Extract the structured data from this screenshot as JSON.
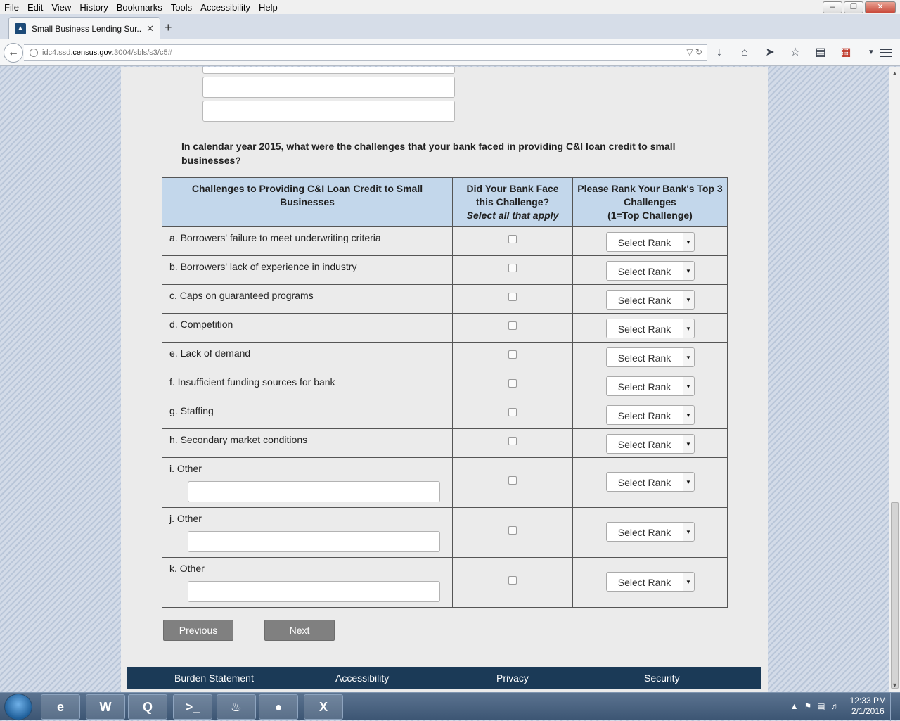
{
  "browser": {
    "menu": [
      "File",
      "Edit",
      "View",
      "History",
      "Bookmarks",
      "Tools",
      "Accessibility",
      "Help"
    ],
    "tab_title": "Small Business Lending Sur...",
    "url_prefix": "idc4.ssd.",
    "url_domain": "census.gov",
    "url_suffix": ":3004/sbls/s3/c5#"
  },
  "question": "In calendar year 2015, what were the challenges that your bank faced in providing C&I loan credit to small businesses?",
  "table": {
    "headers": {
      "challenge": "Challenges to Providing C&I Loan Credit to Small Businesses",
      "faced_line1": "Did Your Bank Face this Challenge?",
      "faced_sub": "Select all that apply",
      "rank_line1": "Please Rank Your Bank's Top 3 Challenges",
      "rank_line2": "(1=Top Challenge)"
    },
    "rows": [
      {
        "letter": "a.",
        "label": "Borrowers' failure to meet underwriting criteria",
        "rank": "Select Rank"
      },
      {
        "letter": "b.",
        "label": "Borrowers' lack of experience in industry",
        "rank": "Select Rank"
      },
      {
        "letter": "c.",
        "label": "Caps on guaranteed programs",
        "rank": "Select Rank"
      },
      {
        "letter": "d.",
        "label": "Competition",
        "rank": "Select Rank"
      },
      {
        "letter": "e.",
        "label": "Lack of demand",
        "rank": "Select Rank"
      },
      {
        "letter": "f.",
        "label": "Insufficient funding sources for bank",
        "rank": "Select Rank"
      },
      {
        "letter": "g.",
        "label": "Staffing",
        "rank": "Select Rank"
      },
      {
        "letter": "h.",
        "label": "Secondary market conditions",
        "rank": "Select Rank"
      },
      {
        "letter": "i.",
        "label": "Other",
        "rank": "Select Rank"
      },
      {
        "letter": "j.",
        "label": "Other",
        "rank": "Select Rank"
      },
      {
        "letter": "k.",
        "label": "Other",
        "rank": "Select Rank"
      }
    ]
  },
  "buttons": {
    "previous": "Previous",
    "next": "Next"
  },
  "footer": [
    "Burden Statement",
    "Accessibility",
    "Privacy",
    "Security"
  ],
  "taskbar": {
    "time": "12:33 PM",
    "date": "2/1/2016"
  }
}
